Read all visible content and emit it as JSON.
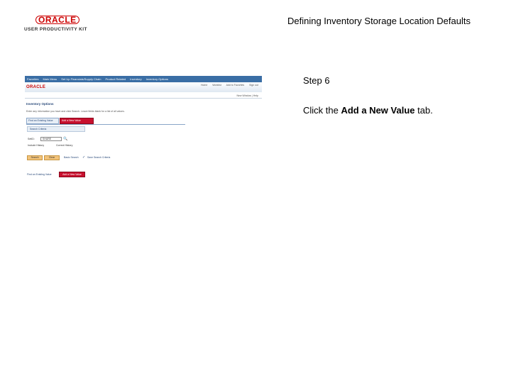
{
  "logo": {
    "brand": "ORACLE",
    "product": "USER PRODUCTIVITY KIT"
  },
  "doc_title": "Defining Inventory Storage Location Defaults",
  "step": {
    "title": "Step 6",
    "instruction_prefix": "Click the ",
    "instruction_target": "Add a New Value",
    "instruction_suffix": " tab."
  },
  "screenshot": {
    "navbar": [
      "Favorites",
      "Main Menu",
      "Set Up Financials/Supply Chain",
      "Product Related",
      "Inventory",
      "Inventory Options"
    ],
    "brand": "ORACLE",
    "top_links": [
      "Home",
      "Worklist",
      "Add to Favorites",
      "Sign out"
    ],
    "new_window": "New Window | Help",
    "page_title": "Inventory Options",
    "page_desc": "Enter any information you have and click Search. Leave fields blank for a list of all values.",
    "tab_find": "Find an Existing Value",
    "tab_add": "Add a New Value",
    "criteria": "Search Criteria",
    "field_label": "SetID:",
    "field_value": "SHARE",
    "check1": "Include History",
    "check2": "Correct History",
    "btn_search": "Search",
    "btn_clear": "Clear",
    "basic_search": "Basic Search",
    "save_criteria": "Save Search Criteria",
    "foot_find": "Find an Existing Value",
    "foot_add": "Add a New Value"
  },
  "colors": {
    "tab_highlight": "#c8102e",
    "logo_red": "#cc0000",
    "navbar": "#3a6ea5"
  }
}
